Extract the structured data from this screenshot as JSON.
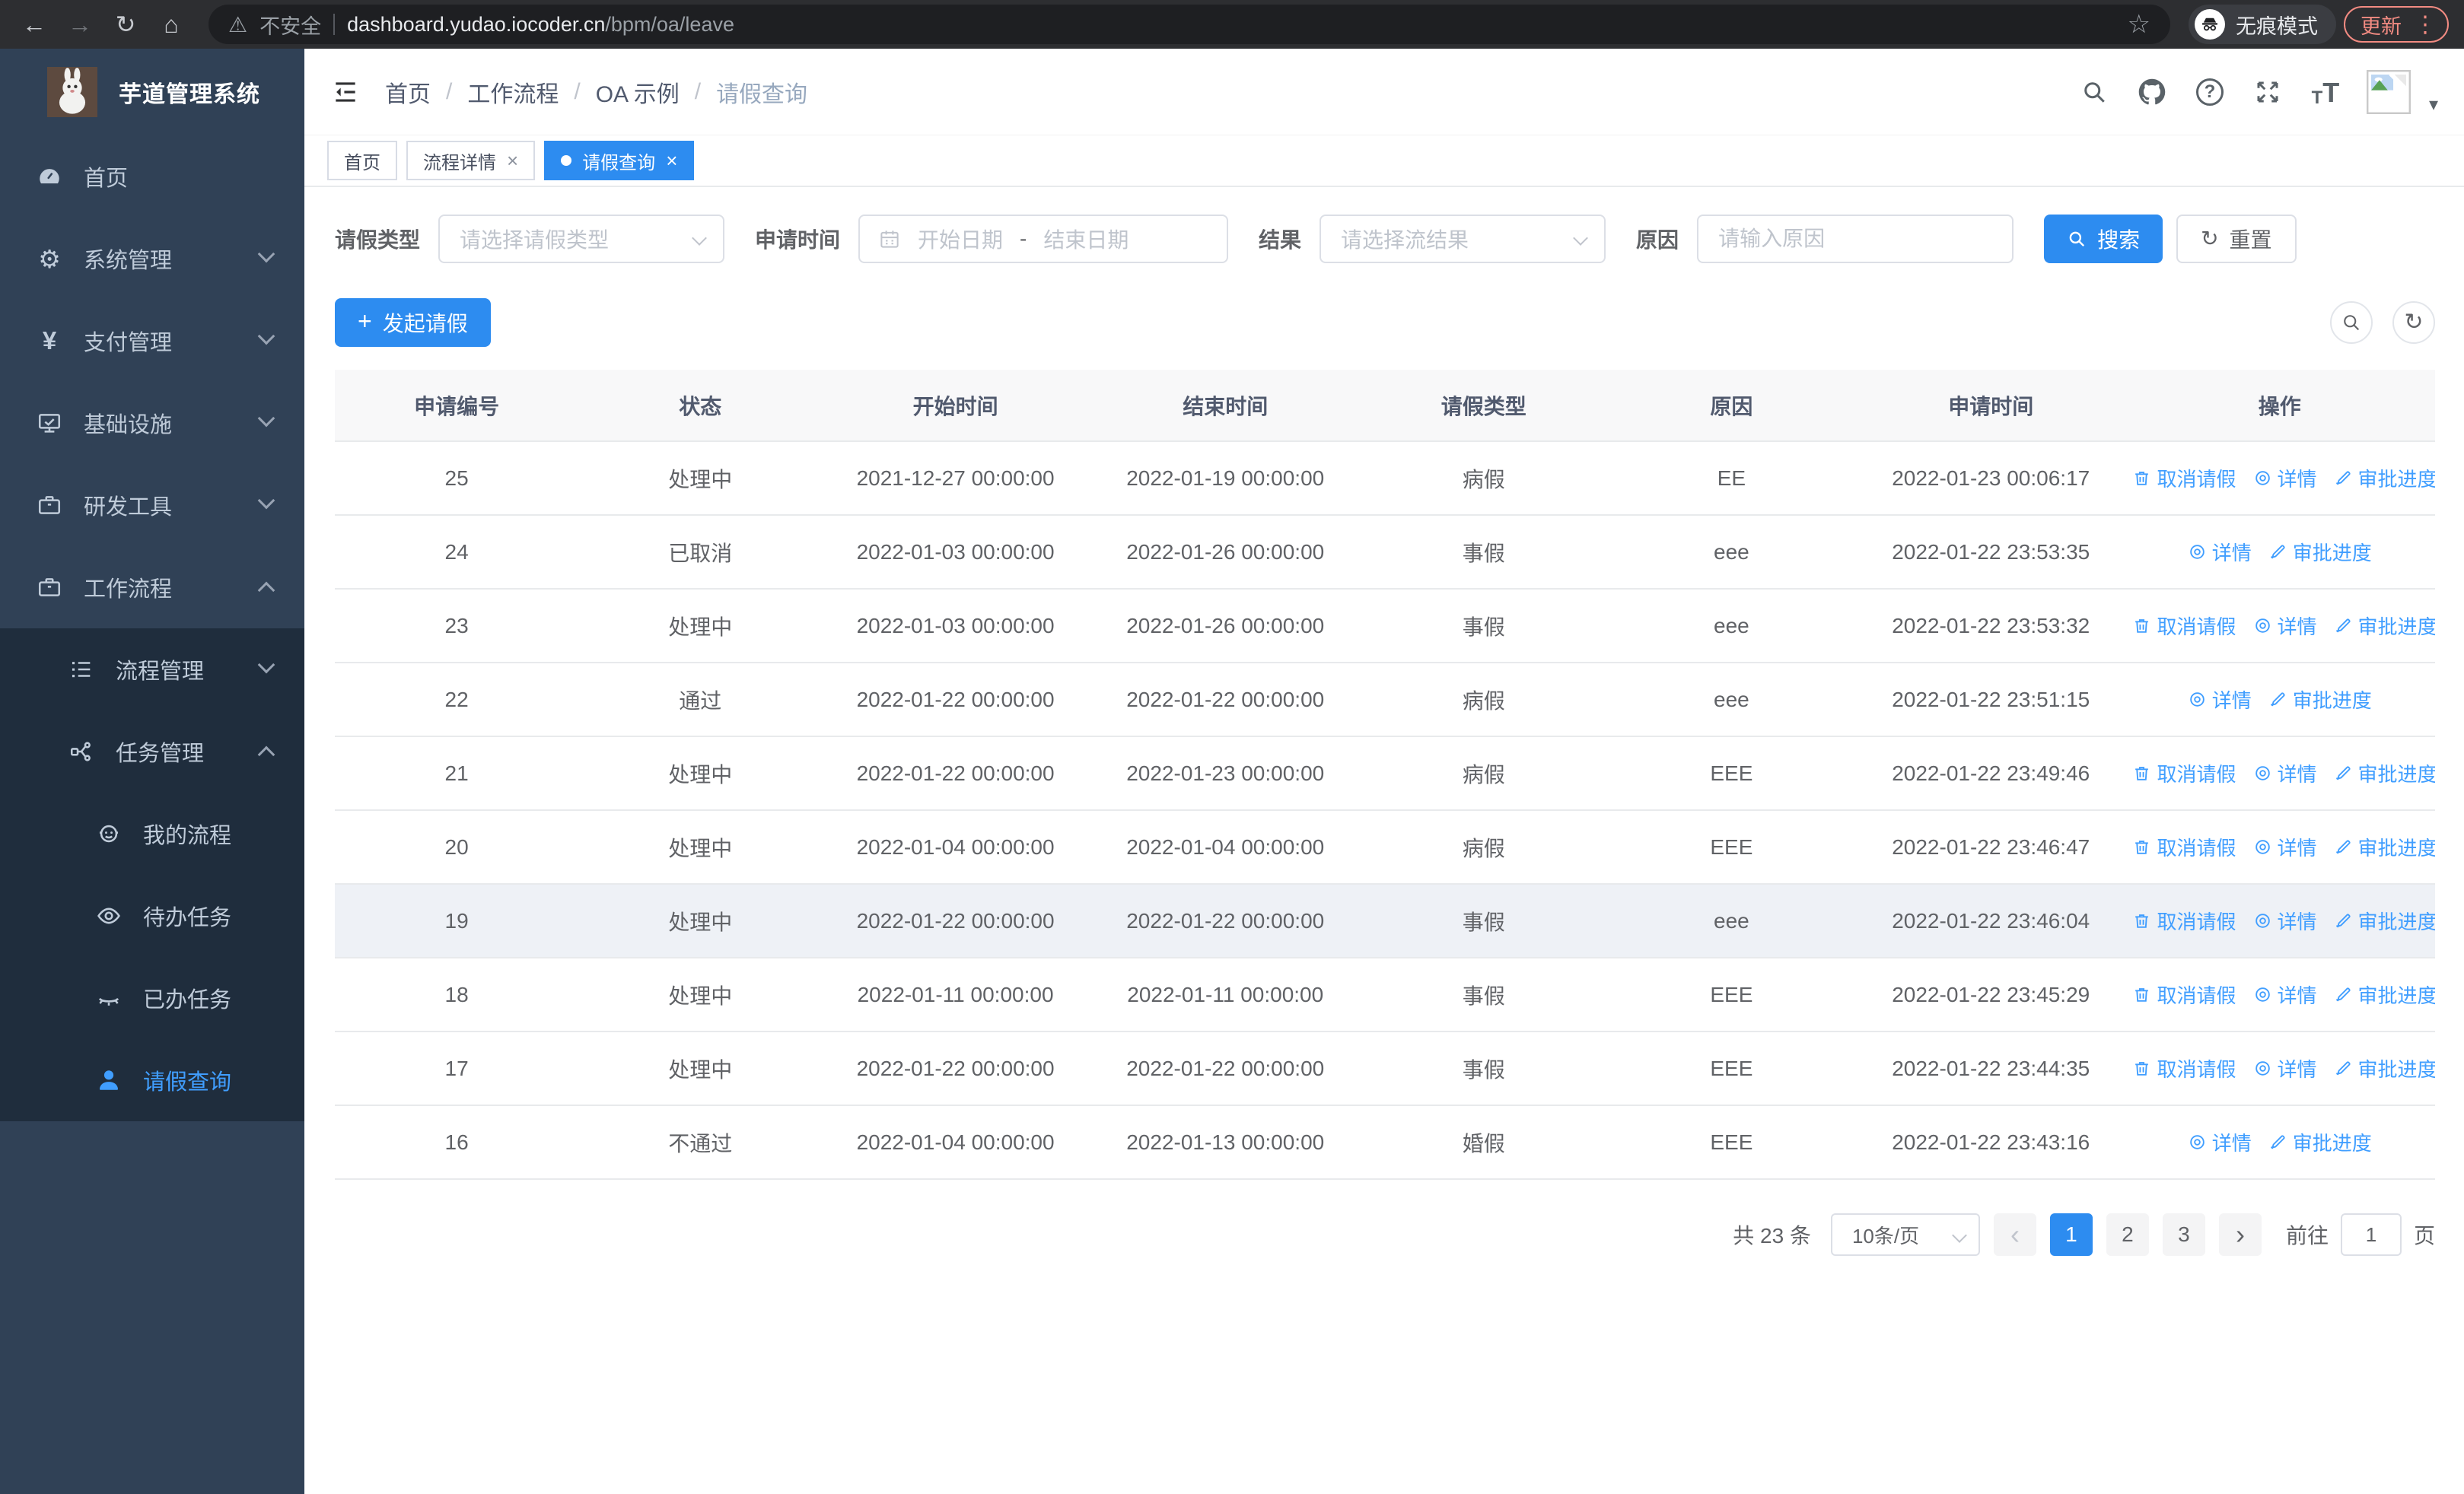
{
  "colors": {
    "primary": "#2d8cf0",
    "link": "#409eff",
    "sidebar_bg": "#304156",
    "submenu_bg": "#1f2d3d",
    "sidebar_text": "#bfcbd9",
    "update": "#f28b82"
  },
  "browser": {
    "security_label": "不安全",
    "url_host": "dashboard.yudao.iocoder.cn",
    "url_path": "/bpm/oa/leave",
    "incognito_label": "无痕模式",
    "update_label": "更新"
  },
  "sidebar": {
    "title": "芋道管理系统",
    "items": [
      {
        "key": "home",
        "label": "首页",
        "icon": "gauge",
        "level": 1
      },
      {
        "key": "system",
        "label": "系统管理",
        "icon": "gear",
        "level": 1,
        "chevron": "down"
      },
      {
        "key": "pay",
        "label": "支付管理",
        "icon": "yen",
        "level": 1,
        "chevron": "down"
      },
      {
        "key": "infra",
        "label": "基础设施",
        "icon": "monitor",
        "level": 1,
        "chevron": "down"
      },
      {
        "key": "dev-tools",
        "label": "研发工具",
        "icon": "briefcase",
        "level": 1,
        "chevron": "down"
      },
      {
        "key": "workflow",
        "label": "工作流程",
        "icon": "briefcase",
        "level": 1,
        "chevron": "up"
      },
      {
        "key": "process-manage",
        "label": "流程管理",
        "icon": "list",
        "level": 2,
        "chevron": "down",
        "submenu": true
      },
      {
        "key": "task-manage",
        "label": "任务管理",
        "icon": "flow",
        "level": 2,
        "chevron": "up",
        "submenu": true
      },
      {
        "key": "my-process",
        "label": "我的流程",
        "icon": "robot",
        "level": 3,
        "submenu": true
      },
      {
        "key": "todo-tasks",
        "label": "待办任务",
        "icon": "eye-open",
        "level": 3,
        "submenu": true
      },
      {
        "key": "done-tasks",
        "label": "已办任务",
        "icon": "eye-closed",
        "level": 3,
        "submenu": true
      },
      {
        "key": "leave-query",
        "label": "请假查询",
        "icon": "user",
        "level": 3,
        "submenu": true,
        "active": true
      }
    ]
  },
  "header": {
    "breadcrumb": [
      "首页",
      "工作流程",
      "OA 示例",
      "请假查询"
    ]
  },
  "tabs": [
    {
      "label": "首页"
    },
    {
      "label": "流程详情",
      "closable": true
    },
    {
      "label": "请假查询",
      "closable": true,
      "active": true
    }
  ],
  "filters": {
    "leave_type": {
      "label": "请假类型",
      "placeholder": "请选择请假类型"
    },
    "apply_time": {
      "label": "申请时间",
      "start_placeholder": "开始日期",
      "separator": "-",
      "end_placeholder": "结束日期"
    },
    "result": {
      "label": "结果",
      "placeholder": "请选择流结果"
    },
    "reason": {
      "label": "原因",
      "placeholder": "请输入原因"
    },
    "search_label": "搜索",
    "reset_label": "重置"
  },
  "toolbar": {
    "create_label": "发起请假"
  },
  "table": {
    "columns": [
      "申请编号",
      "状态",
      "开始时间",
      "结束时间",
      "请假类型",
      "原因",
      "申请时间",
      "操作"
    ],
    "action_labels": {
      "cancel": "取消请假",
      "detail": "详情",
      "progress": "审批进度"
    },
    "rows": [
      {
        "id": "25",
        "status": "处理中",
        "start": "2021-12-27 00:00:00",
        "end": "2022-01-19 00:00:00",
        "type": "病假",
        "reason": "EE",
        "apply_time": "2022-01-23 00:06:17",
        "actions": [
          "cancel",
          "detail",
          "progress"
        ]
      },
      {
        "id": "24",
        "status": "已取消",
        "start": "2022-01-03 00:00:00",
        "end": "2022-01-26 00:00:00",
        "type": "事假",
        "reason": "eee",
        "apply_time": "2022-01-22 23:53:35",
        "actions": [
          "detail",
          "progress"
        ]
      },
      {
        "id": "23",
        "status": "处理中",
        "start": "2022-01-03 00:00:00",
        "end": "2022-01-26 00:00:00",
        "type": "事假",
        "reason": "eee",
        "apply_time": "2022-01-22 23:53:32",
        "actions": [
          "cancel",
          "detail",
          "progress"
        ]
      },
      {
        "id": "22",
        "status": "通过",
        "start": "2022-01-22 00:00:00",
        "end": "2022-01-22 00:00:00",
        "type": "病假",
        "reason": "eee",
        "apply_time": "2022-01-22 23:51:15",
        "actions": [
          "detail",
          "progress"
        ]
      },
      {
        "id": "21",
        "status": "处理中",
        "start": "2022-01-22 00:00:00",
        "end": "2022-01-23 00:00:00",
        "type": "病假",
        "reason": "EEE",
        "apply_time": "2022-01-22 23:49:46",
        "actions": [
          "cancel",
          "detail",
          "progress"
        ]
      },
      {
        "id": "20",
        "status": "处理中",
        "start": "2022-01-04 00:00:00",
        "end": "2022-01-04 00:00:00",
        "type": "病假",
        "reason": "EEE",
        "apply_time": "2022-01-22 23:46:47",
        "actions": [
          "cancel",
          "detail",
          "progress"
        ]
      },
      {
        "id": "19",
        "status": "处理中",
        "start": "2022-01-22 00:00:00",
        "end": "2022-01-22 00:00:00",
        "type": "事假",
        "reason": "eee",
        "apply_time": "2022-01-22 23:46:04",
        "actions": [
          "cancel",
          "detail",
          "progress"
        ],
        "highlighted": true
      },
      {
        "id": "18",
        "status": "处理中",
        "start": "2022-01-11 00:00:00",
        "end": "2022-01-11 00:00:00",
        "type": "事假",
        "reason": "EEE",
        "apply_time": "2022-01-22 23:45:29",
        "actions": [
          "cancel",
          "detail",
          "progress"
        ]
      },
      {
        "id": "17",
        "status": "处理中",
        "start": "2022-01-22 00:00:00",
        "end": "2022-01-22 00:00:00",
        "type": "事假",
        "reason": "EEE",
        "apply_time": "2022-01-22 23:44:35",
        "actions": [
          "cancel",
          "detail",
          "progress"
        ]
      },
      {
        "id": "16",
        "status": "不通过",
        "start": "2022-01-04 00:00:00",
        "end": "2022-01-13 00:00:00",
        "type": "婚假",
        "reason": "EEE",
        "apply_time": "2022-01-22 23:43:16",
        "actions": [
          "detail",
          "progress"
        ]
      }
    ]
  },
  "pagination": {
    "total_text": "共 23 条",
    "page_size": "10条/页",
    "pages": [
      "1",
      "2",
      "3"
    ],
    "active_page": "1",
    "goto_label": "前往",
    "goto_value": "1",
    "page_suffix": "页"
  }
}
